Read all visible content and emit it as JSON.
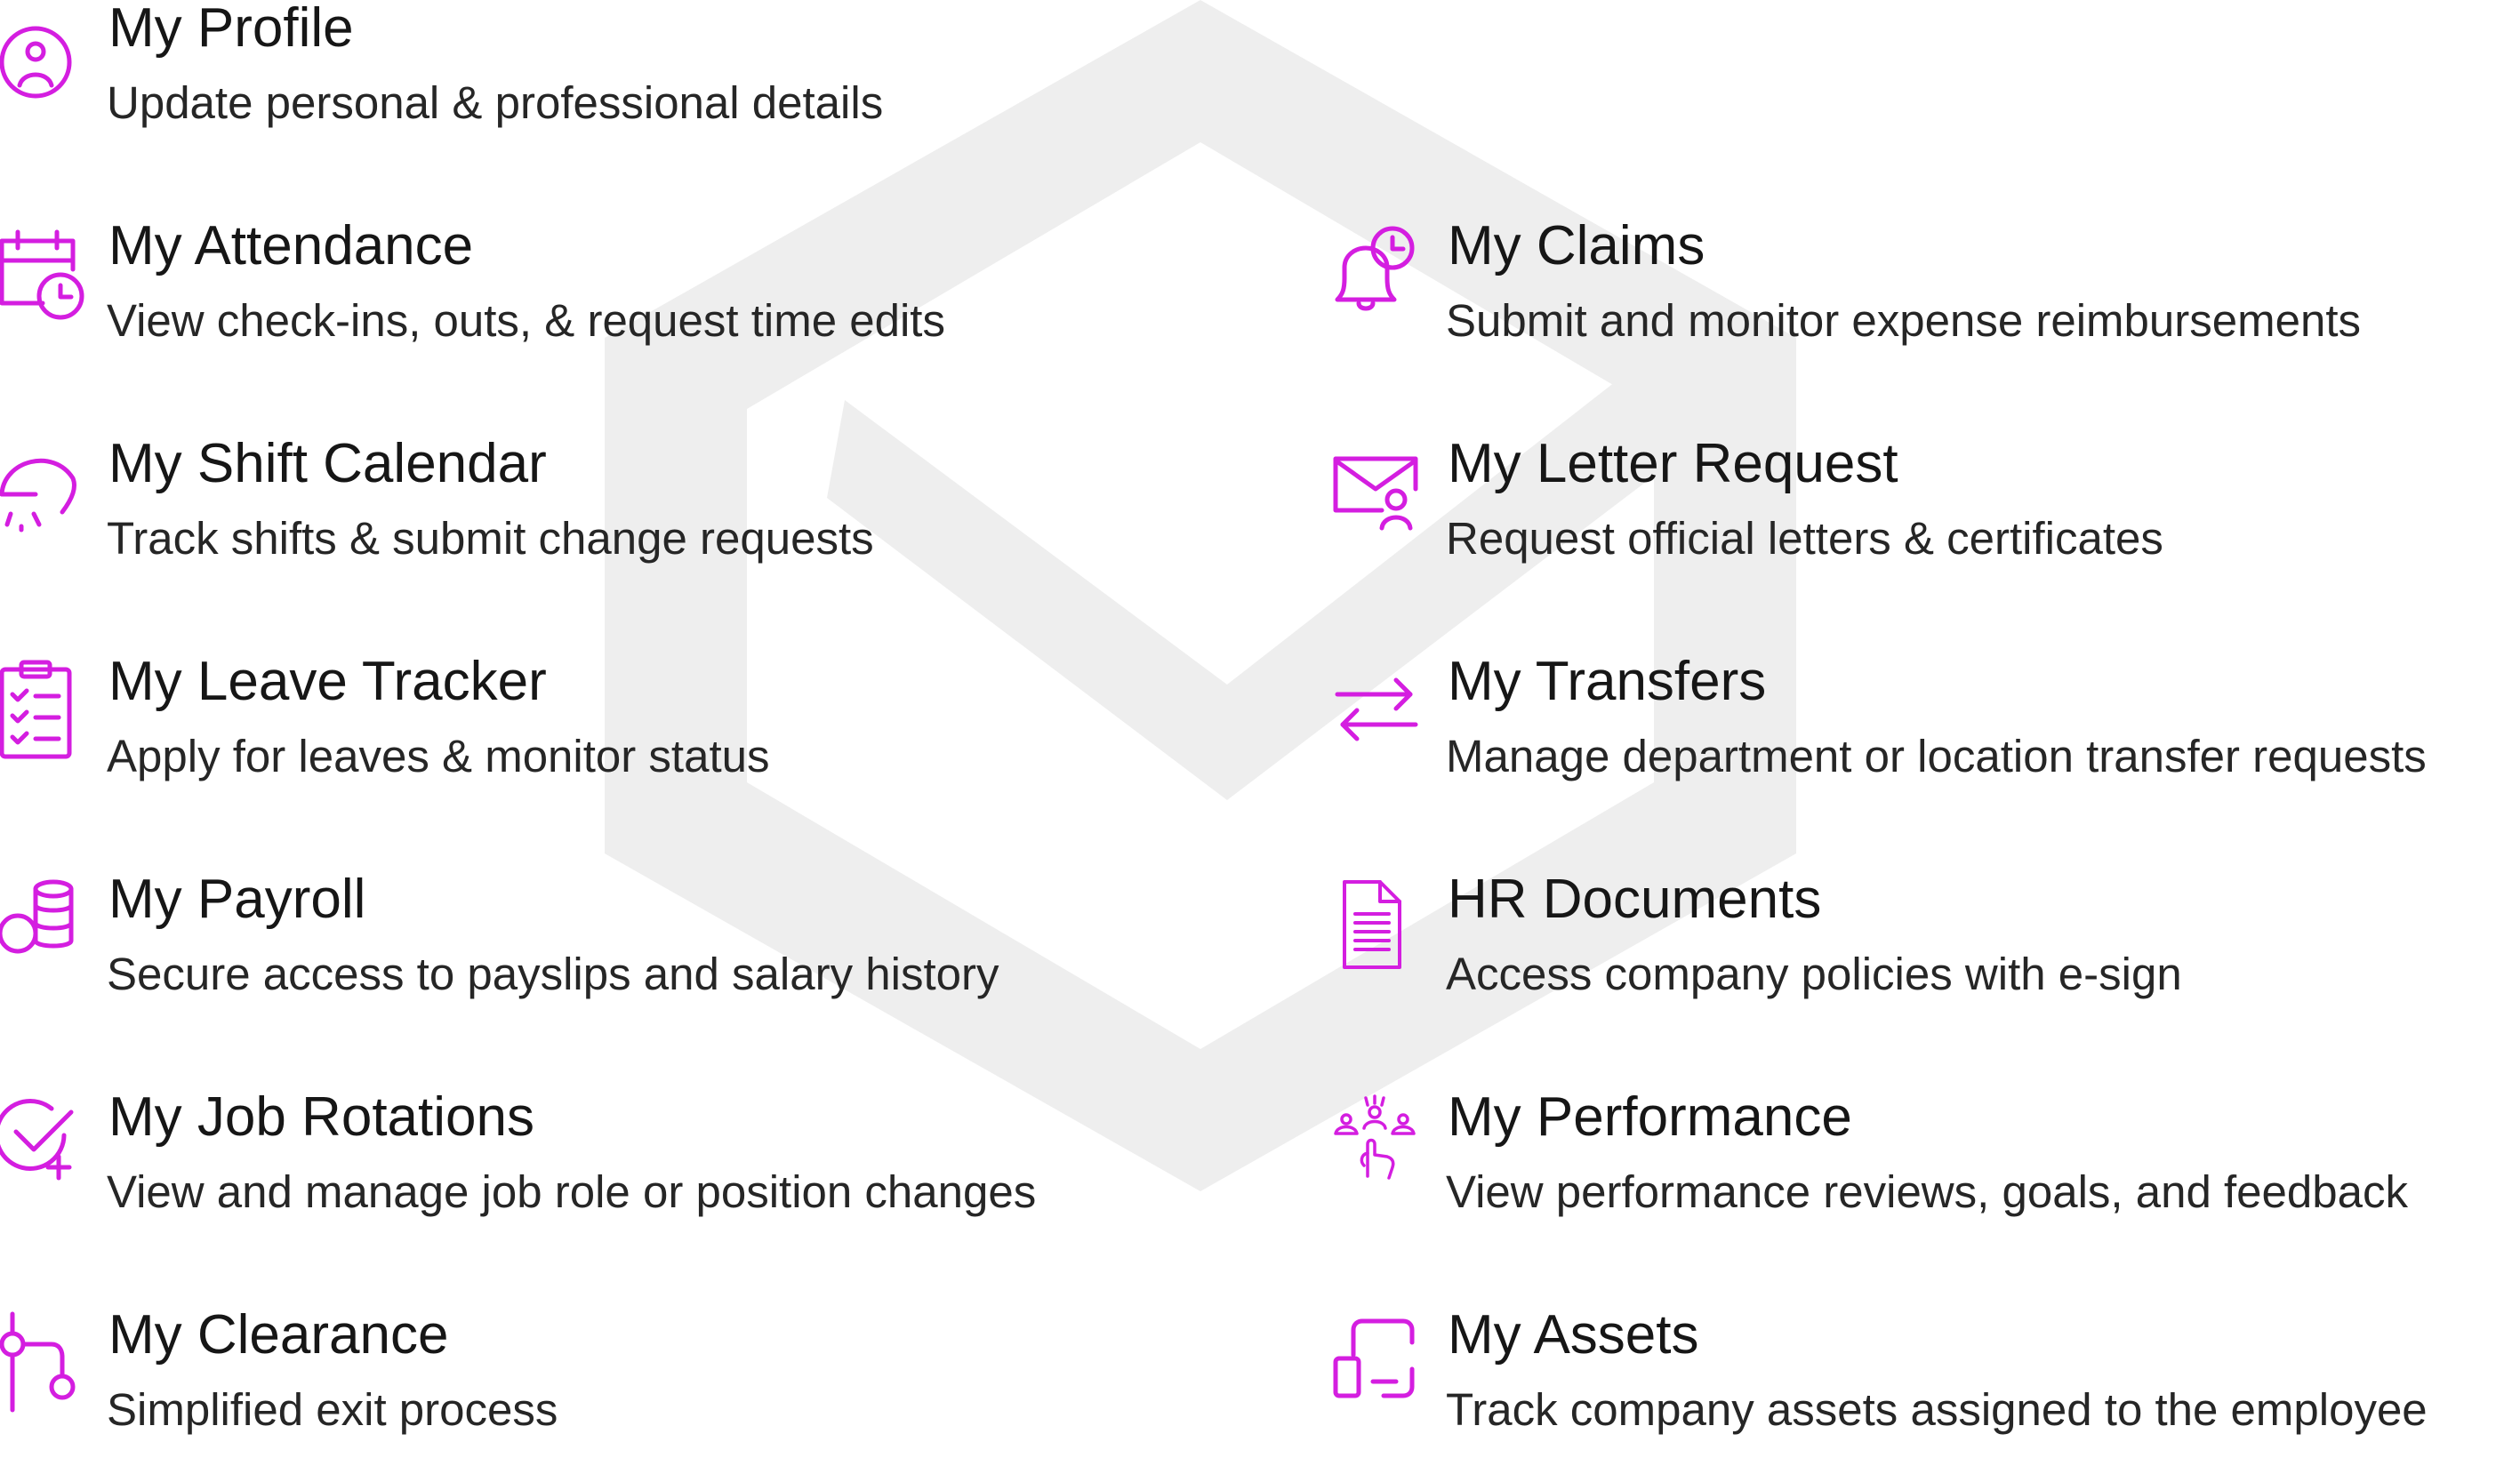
{
  "theme": {
    "accent_color": "#d41ee0",
    "watermark_color": "#eeeeee"
  },
  "features": {
    "left": [
      {
        "icon": "user-profile-icon",
        "title": "My Profile",
        "description": "Update personal & professional details"
      },
      {
        "icon": "calendar-clock-icon",
        "title": "My Attendance",
        "description": "View check-ins, outs, & request time edits"
      },
      {
        "icon": "shift-gauge-icon",
        "title": "My Shift Calendar",
        "description": "Track shifts & submit change requests"
      },
      {
        "icon": "clipboard-checklist-icon",
        "title": "My Leave Tracker",
        "description": "Apply for leaves & monitor status"
      },
      {
        "icon": "coins-stack-icon",
        "title": "My Payroll",
        "description": "Secure access to payslips and salary history"
      },
      {
        "icon": "check-circle-plus-icon",
        "title": "My Job Rotations",
        "description": "View and manage job role or position changes"
      },
      {
        "icon": "git-branch-icon",
        "title": "My Clearance",
        "description": "Simplified exit process"
      }
    ],
    "right": [
      {
        "icon": "bell-clock-icon",
        "title": "My Claims",
        "description": "Submit and monitor expense reimbursements"
      },
      {
        "icon": "envelope-user-icon",
        "title": "My Letter Request",
        "description": "Request official letters & certificates"
      },
      {
        "icon": "transfer-arrows-icon",
        "title": "My Transfers",
        "description": "Manage department or location transfer requests"
      },
      {
        "icon": "document-icon",
        "title": "HR Documents",
        "description": "Access company policies with e-sign"
      },
      {
        "icon": "team-pointer-icon",
        "title": "My Performance",
        "description": "View performance reviews, goals, and feedback"
      },
      {
        "icon": "asset-frame-icon",
        "title": "My Assets",
        "description": "Track company assets assigned to the employee"
      }
    ]
  }
}
